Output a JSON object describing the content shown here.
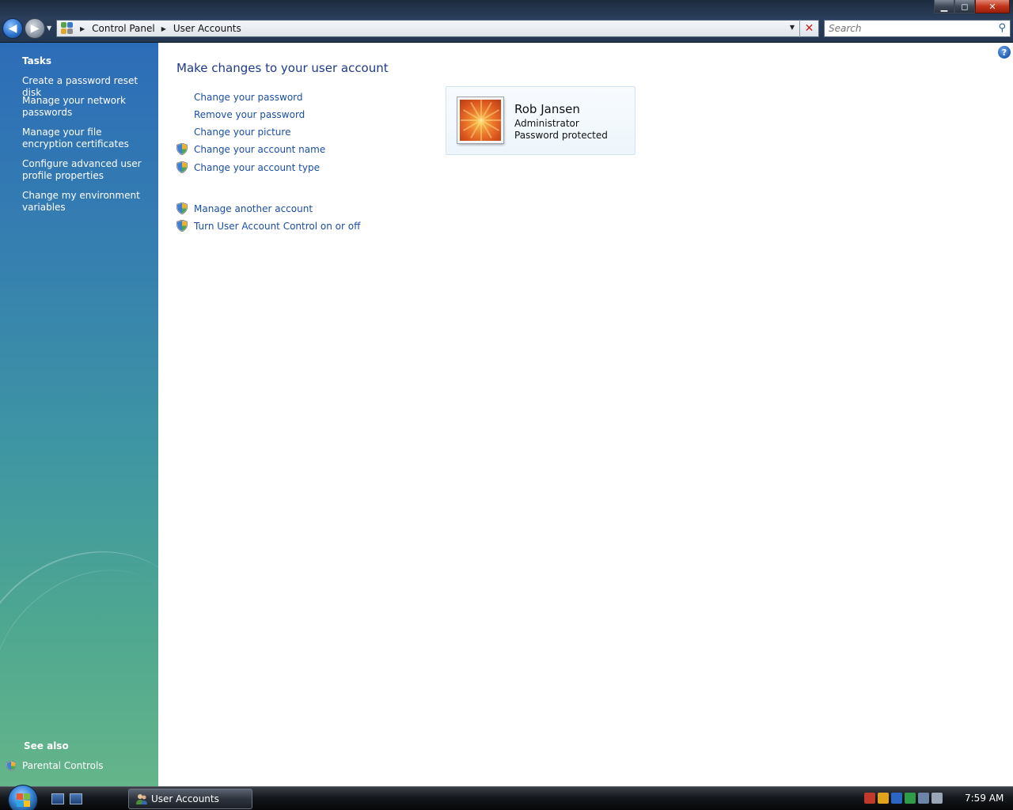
{
  "window": {
    "address": {
      "crumbs": [
        "Control Panel",
        "User Accounts"
      ]
    },
    "search": {
      "placeholder": "Search"
    },
    "controls": {
      "minimize": "▁",
      "maximize": "◻",
      "close": "✕"
    }
  },
  "taskpane": {
    "tasks_heading": "Tasks",
    "tasks": [
      {
        "label": "Create a password reset disk"
      },
      {
        "label": "Manage your network passwords"
      },
      {
        "label": "Manage your file encryption certificates"
      },
      {
        "label": "Configure advanced user profile properties"
      },
      {
        "label": "Change my environment variables"
      }
    ],
    "see_also_heading": "See also",
    "see_also": [
      {
        "label": "Parental Controls",
        "icon": "shield-icon"
      }
    ]
  },
  "main": {
    "title": "Make changes to your user account",
    "links": [
      {
        "label": "Change your password",
        "shield": false
      },
      {
        "label": "Remove your password",
        "shield": false
      },
      {
        "label": "Change your picture",
        "shield": false
      },
      {
        "label": "Change your account name",
        "shield": true
      },
      {
        "label": "Change your account type",
        "shield": true
      }
    ],
    "links2": [
      {
        "label": "Manage another account",
        "shield": true
      },
      {
        "label": "Turn User Account Control on or off",
        "shield": true
      }
    ],
    "account": {
      "name": "Rob Jansen",
      "role": "Administrator",
      "status": "Password protected"
    }
  },
  "taskbar": {
    "active_window": "User Accounts",
    "clock": "7:59 AM"
  },
  "colors": {
    "link": "#1a4fa3",
    "title": "#1e3a8a",
    "card_border": "#cfe3f2"
  }
}
